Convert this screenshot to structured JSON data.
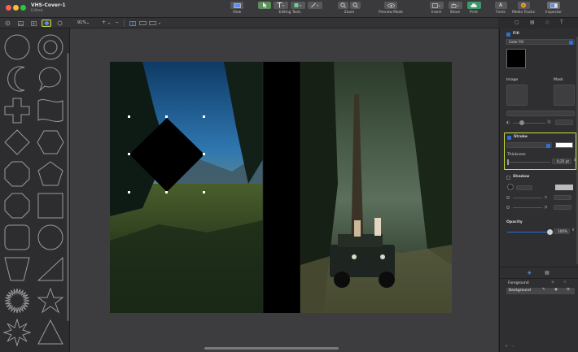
{
  "window": {
    "title": "VHS-Cover-1",
    "subtitle": "Edited",
    "traffic_lights": [
      "#fe5f57",
      "#febc2e",
      "#28c840"
    ]
  },
  "toolbar": {
    "view": "View",
    "editing_tools": "Editing Tools",
    "zoom": "Zoom",
    "preview_mode": "Preview Mode",
    "insert": "Insert",
    "share": "Share",
    "print": "Print",
    "fonts": "Fonts",
    "media_tracks": "Media Tracks",
    "inspector": "Inspector"
  },
  "subbar": {
    "zoom_value": "91%",
    "zoom_plus": "+",
    "zoom_minus": "−"
  },
  "inspector": {
    "fill_label": "Fill",
    "fill_type": "Color Fill",
    "image_label": "Image",
    "mask_label": "Mask",
    "stroke_label": "Stroke",
    "thickness_label": "Thickness",
    "thickness_value": "0,25 pt",
    "shadow_label": "Shadow",
    "opacity_label": "Opacity",
    "opacity_value": "100%",
    "opacity_level": 1.0,
    "layers": {
      "foreground": "Foreground",
      "background": "Background"
    }
  },
  "colors": {
    "accent": "#2f6fd6",
    "highlight": "#c9e33a",
    "fill_swatch": "#000000",
    "stroke_swatch": "#ffffff"
  }
}
